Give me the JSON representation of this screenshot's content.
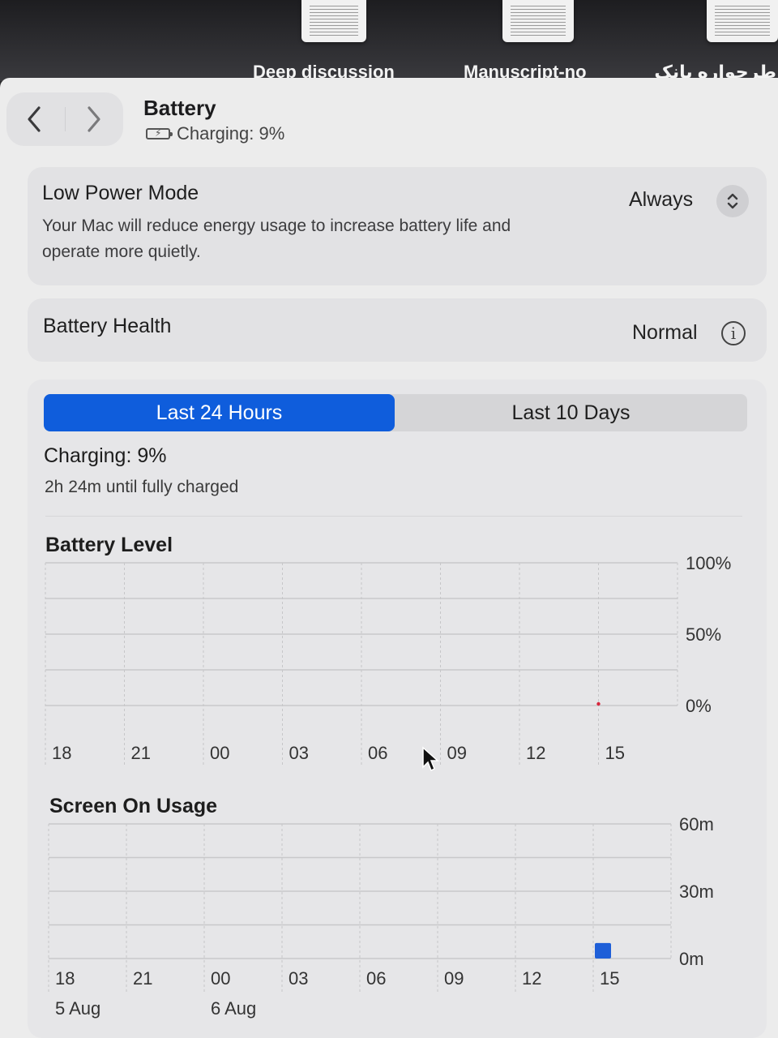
{
  "desktop": {
    "labels": [
      "Deep discussion",
      "Manuscript-no",
      "طرحواره بانک"
    ]
  },
  "header": {
    "back_icon": "chevron-left-icon",
    "forward_icon": "chevron-right-icon",
    "title": "Battery",
    "subtitle": "Charging: 9%",
    "battery_icon": "battery-charging-icon"
  },
  "low_power": {
    "title": "Low Power Mode",
    "description_line1": "Your Mac will reduce energy usage to increase battery life and",
    "description_line2": "operate more quietly.",
    "value": "Always",
    "stepper_icon": "up-down-chevron-icon"
  },
  "health": {
    "title": "Battery Health",
    "value": "Normal",
    "info_icon": "info-icon"
  },
  "tabs": [
    {
      "label": "Last 24 Hours",
      "active": true
    },
    {
      "label": "Last 10 Days",
      "active": false
    }
  ],
  "status": {
    "main": "Charging: 9%",
    "sub": "2h 24m until fully charged"
  },
  "colors": {
    "accent": "#0f5ddc",
    "battery_point": "#d7263d",
    "usage_bar": "#1e5fd8"
  },
  "chart_data": [
    {
      "type": "line",
      "title": "Battery Level",
      "x": [
        "18",
        "21",
        "00",
        "03",
        "06",
        "09",
        "12",
        "15"
      ],
      "y_ticks": [
        "100%",
        "50%",
        "0%"
      ],
      "ylim": [
        0,
        100
      ],
      "grid": true,
      "series": [
        {
          "points": [
            {
              "x": "15",
              "y": 0
            }
          ]
        }
      ]
    },
    {
      "type": "bar",
      "title": "Screen On Usage",
      "x": [
        "18",
        "21",
        "00",
        "03",
        "06",
        "09",
        "12",
        "15"
      ],
      "date_labels": [
        {
          "at": "18",
          "label": "5 Aug"
        },
        {
          "at": "00",
          "label": "6 Aug"
        }
      ],
      "y_ticks": [
        "60m",
        "30m",
        "0m"
      ],
      "ylim": [
        0,
        60
      ],
      "grid": true,
      "series": [
        {
          "values": [
            0,
            0,
            0,
            0,
            0,
            0,
            0,
            4
          ]
        }
      ]
    }
  ]
}
